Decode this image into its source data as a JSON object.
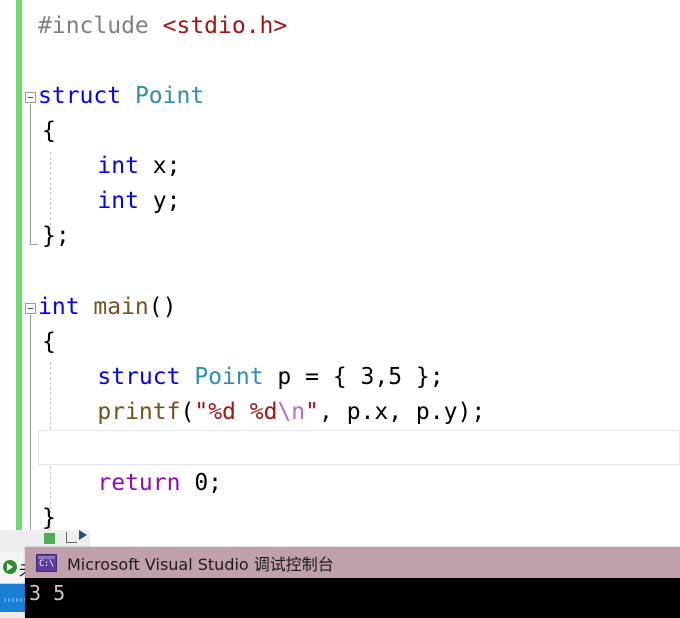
{
  "editor": {
    "name": "visual-studio-code-editor",
    "background": "#ffffff",
    "change_bar_color": "#6fdb6f",
    "current_line_border": "#e6e6f0",
    "colors": {
      "preprocessor": "#808080",
      "string": "#a31515",
      "keyword": "#0000ff",
      "type": "#2b91af",
      "function": "#74531f",
      "escape": "#b06ce0",
      "control_keyword": "#8f08c4",
      "plain": "#000000"
    },
    "lines": [
      {
        "index": 0,
        "tokens": [
          {
            "text": "#include ",
            "kind": "pp"
          },
          {
            "text": "<stdio.h>",
            "kind": "str"
          }
        ]
      },
      {
        "index": 1,
        "tokens": []
      },
      {
        "index": 2,
        "tokens": [
          {
            "text": "struct ",
            "kind": "kw"
          },
          {
            "text": "Point",
            "kind": "type"
          }
        ]
      },
      {
        "index": 3,
        "tokens": [
          {
            "text": "{",
            "kind": "plain"
          }
        ]
      },
      {
        "index": 4,
        "tokens": [
          {
            "text": "    ",
            "kind": "plain"
          },
          {
            "text": "int ",
            "kind": "kw"
          },
          {
            "text": "x;",
            "kind": "plain"
          }
        ]
      },
      {
        "index": 5,
        "tokens": [
          {
            "text": "    ",
            "kind": "plain"
          },
          {
            "text": "int ",
            "kind": "kw"
          },
          {
            "text": "y;",
            "kind": "plain"
          }
        ]
      },
      {
        "index": 6,
        "tokens": [
          {
            "text": "};",
            "kind": "plain"
          }
        ]
      },
      {
        "index": 7,
        "tokens": []
      },
      {
        "index": 8,
        "tokens": [
          {
            "text": "int ",
            "kind": "kw"
          },
          {
            "text": "main",
            "kind": "fn"
          },
          {
            "text": "()",
            "kind": "plain"
          }
        ]
      },
      {
        "index": 9,
        "tokens": [
          {
            "text": "{",
            "kind": "plain"
          }
        ]
      },
      {
        "index": 10,
        "tokens": [
          {
            "text": "    ",
            "kind": "plain"
          },
          {
            "text": "struct ",
            "kind": "kw"
          },
          {
            "text": "Point",
            "kind": "type"
          },
          {
            "text": " p = { 3,5 };",
            "kind": "plain"
          }
        ]
      },
      {
        "index": 11,
        "tokens": [
          {
            "text": "    ",
            "kind": "plain"
          },
          {
            "text": "printf",
            "kind": "fn"
          },
          {
            "text": "(",
            "kind": "plain"
          },
          {
            "text": "\"%d %d",
            "kind": "str"
          },
          {
            "text": "\\n",
            "kind": "esc"
          },
          {
            "text": "\"",
            "kind": "str"
          },
          {
            "text": ", p.x, p.y);",
            "kind": "plain"
          }
        ]
      },
      {
        "index": 12,
        "tokens": [],
        "current": true
      },
      {
        "index": 13,
        "tokens": [
          {
            "text": "    ",
            "kind": "plain"
          },
          {
            "text": "return ",
            "kind": "ctrl"
          },
          {
            "text": "0;",
            "kind": "plain"
          }
        ]
      },
      {
        "index": 14,
        "tokens": [
          {
            "text": "}",
            "kind": "plain"
          }
        ]
      }
    ]
  },
  "console_window": {
    "title": "Microsoft Visual Studio 调试控制台",
    "icon": "console-app-icon",
    "icon_prompt": "C:\\",
    "titlebar_color": "#bfa0ac",
    "output": "3 5",
    "output_color": "#c8c8c8",
    "background": "#000000"
  },
  "background_window": {
    "label": "未",
    "play_icon": "run-icon",
    "selected_row_color": "#1a7fd4"
  }
}
